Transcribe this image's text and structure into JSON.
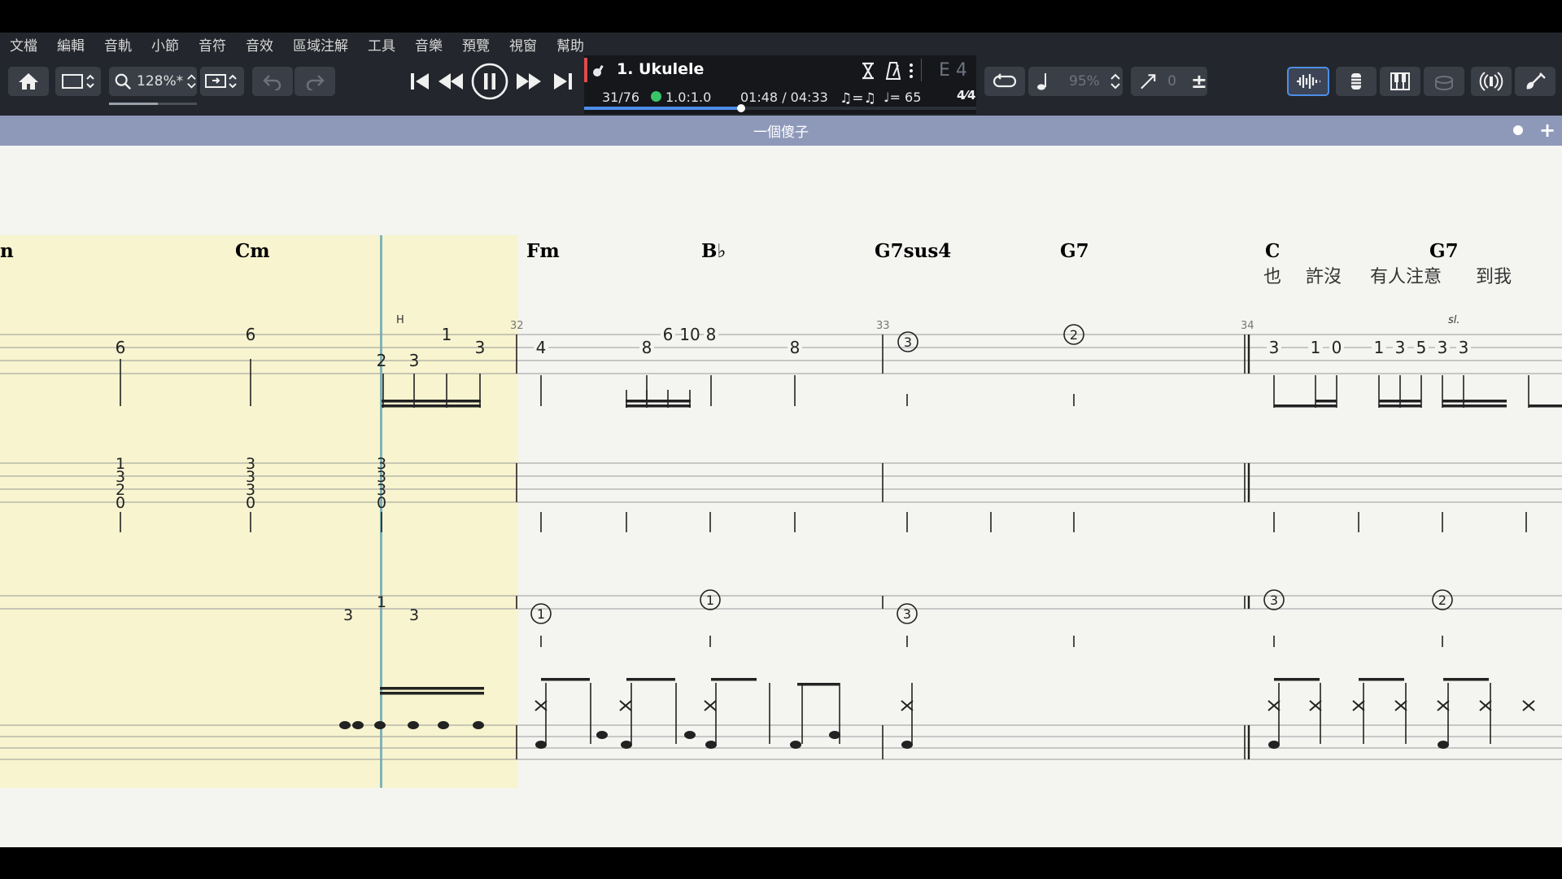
{
  "menu": [
    "文檔",
    "編輯",
    "音軌",
    "小節",
    "音符",
    "音效",
    "區域注解",
    "工具",
    "音樂",
    "預覽",
    "視窗",
    "幫助"
  ],
  "toolbar": {
    "zoom": "128%*",
    "track_name": "1. Ukulele",
    "bar_position": "31/76",
    "signature": "1.0:1.0",
    "time": "01:48 / 04:33",
    "tempo": "♩= 65",
    "key": "E 4",
    "speed": "95%",
    "pitch": "0",
    "progress": 0.4
  },
  "score_title": "一個傻子",
  "icons": [
    "home-icon",
    "layout-icon",
    "zoom-icon",
    "screen-icon",
    "undo-icon",
    "redo-icon",
    "skip-start-icon",
    "rewind-icon",
    "pause-icon",
    "fast-forward-icon",
    "skip-end-icon",
    "ukulele-icon",
    "hourglass-icon",
    "metronome-icon",
    "more-icon",
    "loop-icon",
    "note-icon",
    "tuning-icon",
    "plus-minus-icon",
    "sound-icon",
    "mixer-icon",
    "piano-icon",
    "drum-icon",
    "broadcast-icon",
    "guitar-icon"
  ],
  "colors": {
    "menubar": "#23262c",
    "title_strip": "#8e99ba",
    "score_bg": "#f4f5f1",
    "highlight": "#f7f4cf",
    "cursor": "#7fb3b9",
    "progress": "#4d8ee8"
  },
  "score": {
    "chords": [
      "n",
      "Cm",
      "Fm",
      "B♭",
      "G7sus4",
      "G7",
      "C",
      "G7"
    ],
    "lyrics": [
      "也",
      "許沒",
      "有人注意",
      "到我"
    ],
    "bar_numbers": [
      "32",
      "33",
      "34"
    ],
    "marks": {
      "hammer": "H",
      "slide": "sl."
    },
    "tab1_fret_numbers": [
      "6",
      "6",
      "2",
      "3",
      "1",
      "3",
      "4",
      "8",
      "6",
      "10",
      "8",
      "8",
      "3",
      "1",
      "0",
      "1",
      "3",
      "5",
      "3",
      "3"
    ],
    "tab2_fret_numbers": [
      "1",
      "3",
      "2",
      "0",
      "3",
      "3",
      "3",
      "0",
      "3",
      "3",
      "3",
      "0"
    ],
    "tab3_fret_numbers": [
      "3",
      "1",
      "3"
    ],
    "circled_strings": [
      "3",
      "2",
      "1",
      "1",
      "3",
      "3",
      "2"
    ]
  }
}
